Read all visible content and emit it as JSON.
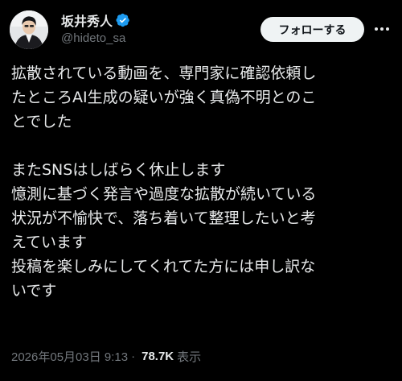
{
  "user": {
    "display_name": "坂井秀人",
    "handle": "@hideto_sa",
    "verified": true
  },
  "actions": {
    "follow_label": "フォローする",
    "more_icon": "more-dots-icon"
  },
  "tweet": {
    "lines": [
      "拡散されている動画を、専門家に確認依頼し",
      "たところAI生成の疑いが強く真偽不明とのこ",
      "とでした",
      "",
      "またSNSはしばらく休止します",
      "憶測に基づく発言や過度な拡散が続いている",
      "状況が不愉快で、落ち着いて整理したいと考",
      "えています",
      "投稿を楽しみにしてくれてた方には申し訳な",
      "いです"
    ]
  },
  "meta": {
    "timestamp": "2026年05月03日 9:13",
    "separator": "·",
    "views_count": "78.7K",
    "views_label": "表示"
  },
  "colors": {
    "background": "#000000",
    "text": "#e7e9ea",
    "secondary": "#71767b",
    "verified_badge": "#1d9bf0",
    "button_bg": "#eff3f4"
  }
}
